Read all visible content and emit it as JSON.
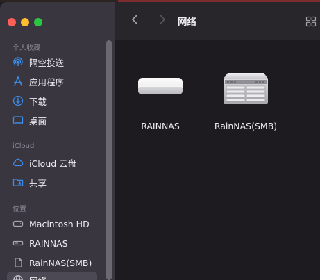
{
  "window": {
    "title": "网络"
  },
  "sidebar": {
    "sections": [
      {
        "header": "个人收藏",
        "items": [
          {
            "label": "隔空投送",
            "icon": "airdrop-icon"
          },
          {
            "label": "应用程序",
            "icon": "applications-icon"
          },
          {
            "label": "下载",
            "icon": "downloads-icon"
          },
          {
            "label": "桌面",
            "icon": "desktop-icon"
          }
        ]
      },
      {
        "header": "iCloud",
        "items": [
          {
            "label": "iCloud 云盘",
            "icon": "icloud-icon"
          },
          {
            "label": "共享",
            "icon": "shared-folder-icon"
          }
        ]
      },
      {
        "header": "位置",
        "items": [
          {
            "label": "Macintosh HD",
            "icon": "hard-drive-icon"
          },
          {
            "label": "RAINNAS",
            "icon": "server-icon"
          },
          {
            "label": "RainNAS(SMB)",
            "icon": "network-volume-icon"
          },
          {
            "label": "网络",
            "icon": "network-globe-icon",
            "selected": true
          }
        ]
      }
    ]
  },
  "toolbar": {
    "back_icon": "chevron-left-icon",
    "forward_icon": "chevron-right-icon",
    "view_icon": "grid-view-icon"
  },
  "content": {
    "devices": [
      {
        "label": "RAINNAS",
        "icon": "time-capsule-icon"
      },
      {
        "label": "RainNAS(SMB)",
        "icon": "rack-server-icon"
      }
    ]
  },
  "colors": {
    "accent": "#3b8eea",
    "sidebar_bg": "#3a3640",
    "content_bg": "#1d1b1f"
  }
}
